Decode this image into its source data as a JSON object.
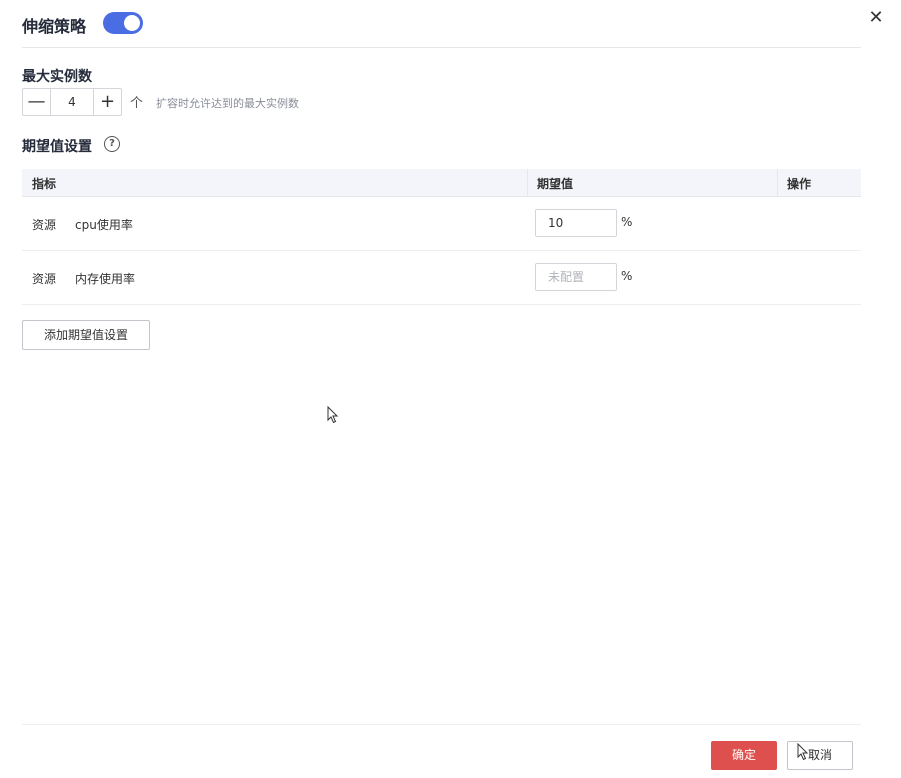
{
  "header": {
    "title": "伸缩策略",
    "toggle_on": true,
    "close_icon": "close-icon",
    "accent_color": "#4a6de3"
  },
  "max_instances": {
    "label": "最大实例数",
    "value": "4",
    "minus": "—",
    "plus": "+",
    "arrow": "个",
    "hint": "扩容时允许达到的最大实例数"
  },
  "expect": {
    "label": "期望值设置",
    "help_icon": "help-icon",
    "columns": [
      "指标",
      "期望值",
      "操作"
    ],
    "rows": [
      {
        "type": "资源",
        "name": "cpu使用率",
        "value": "10",
        "placeholder": "",
        "unit": "%"
      },
      {
        "type": "资源",
        "name": "内存使用率",
        "value": "",
        "placeholder": "未配置",
        "unit": "%"
      }
    ],
    "add_button": "添加期望值设置"
  },
  "footer": {
    "ok_label": "确定",
    "cancel_label": "取消",
    "ok_color": "#de504e"
  }
}
